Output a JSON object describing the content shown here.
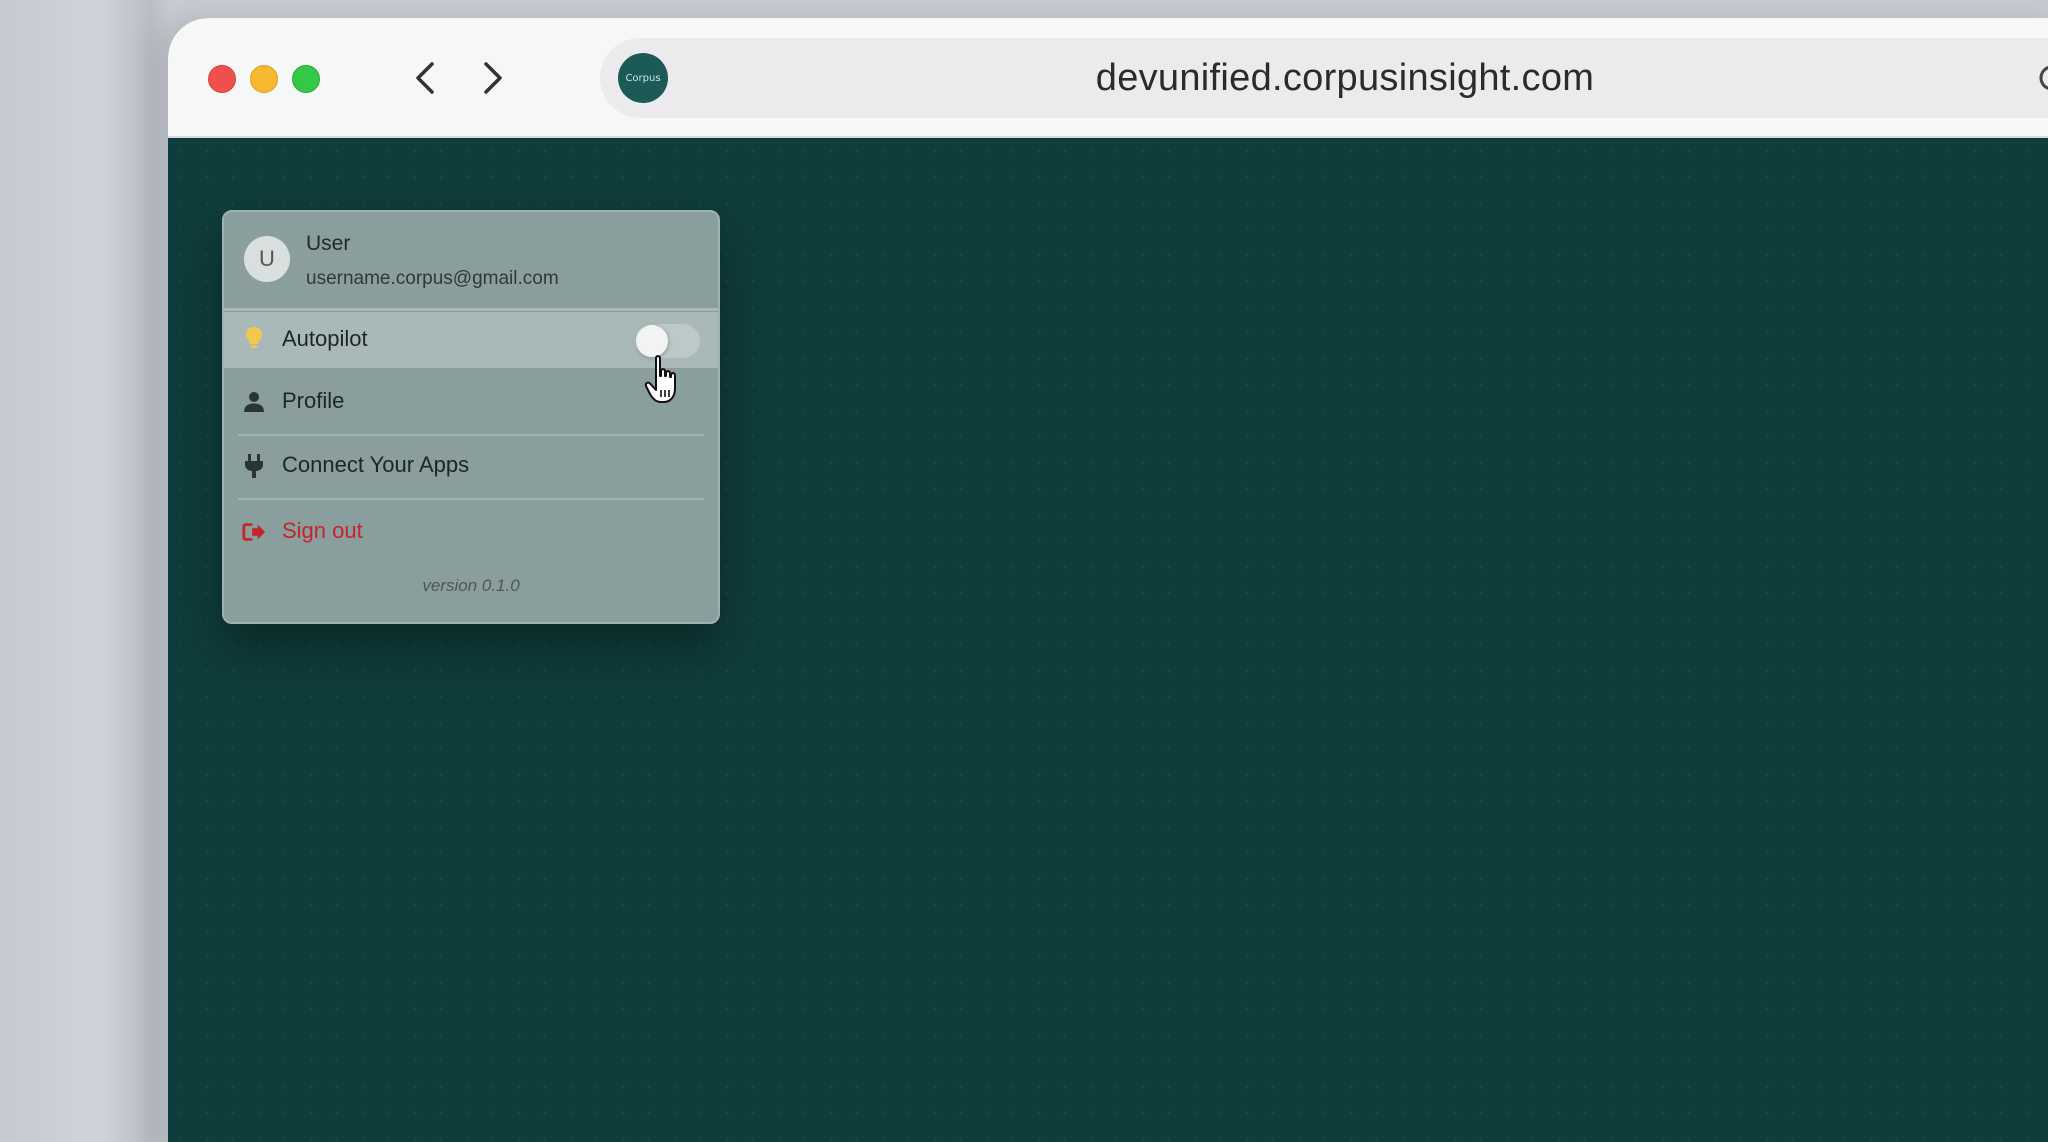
{
  "browser": {
    "url": "devunified.corpusinsight.com",
    "site_logo_text": "Corpus",
    "icons": {
      "back": "chevron-left-icon",
      "forward": "chevron-right-icon",
      "reload": "reload-icon"
    }
  },
  "menu": {
    "user": {
      "avatar_letter": "U",
      "name": "User",
      "email": "username.corpus@gmail.com"
    },
    "items": [
      {
        "label": "Autopilot",
        "icon": "lightbulb-icon",
        "toggle_on": false
      },
      {
        "label": "Profile",
        "icon": "person-icon"
      },
      {
        "label": "Connect Your Apps",
        "icon": "plug-icon"
      },
      {
        "label": "Sign out",
        "icon": "sign-out-icon",
        "color": "#c4242b"
      }
    ],
    "version": "version 0.1.0"
  },
  "colors": {
    "background": "#0f3d3b",
    "menu_bg": "#8a9e9d",
    "signout": "#c4242b",
    "bulb": "#f2c94c"
  }
}
